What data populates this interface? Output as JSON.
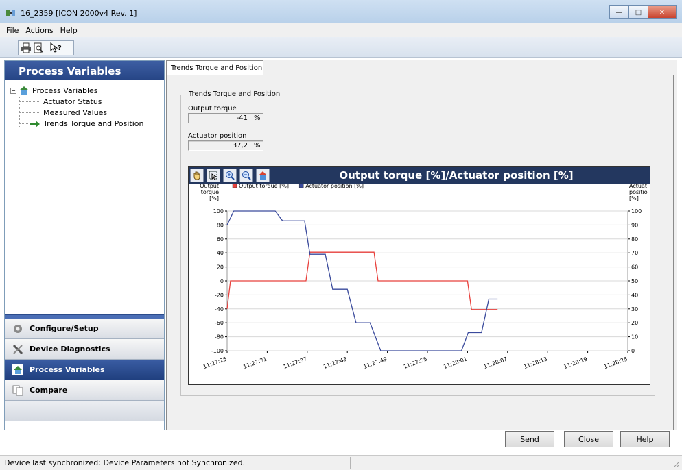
{
  "window": {
    "title": "16_2359 [ICON 2000v4 Rev. 1]",
    "controls": [
      "minimize",
      "maximize",
      "close"
    ]
  },
  "menu": [
    "File",
    "Actions",
    "Help"
  ],
  "toolbar": {
    "icons": [
      "print-icon",
      "print-preview-icon",
      "context-help-icon"
    ]
  },
  "left_panel": {
    "header": "Process Variables",
    "tree": {
      "root": "Process Variables",
      "children": [
        "Actuator Status",
        "Measured Values",
        "Trends Torque and Position"
      ],
      "selected": "Trends Torque and Position"
    },
    "nav": [
      {
        "label": "Configure/Setup",
        "icon": "gear-icon",
        "active": false
      },
      {
        "label": "Device Diagnostics",
        "icon": "tools-icon",
        "active": false
      },
      {
        "label": "Process Variables",
        "icon": "home-icon",
        "active": true
      },
      {
        "label": "Compare",
        "icon": "compare-icon",
        "active": false
      }
    ]
  },
  "main": {
    "tab": "Trends Torque and Position",
    "group_title": "Trends Torque and Position",
    "output_torque": {
      "label": "Output torque",
      "value": "-41",
      "unit": "%"
    },
    "actuator_position": {
      "label": "Actuator position",
      "value": "37,2",
      "unit": "%"
    }
  },
  "chart_data": {
    "type": "line",
    "title": "Output torque [%]/Actuator position [%]",
    "toolbar_icons": [
      "pan-hand-icon",
      "zoom-select-icon",
      "zoom-in-icon",
      "zoom-out-icon",
      "home-icon"
    ],
    "ylabel_left": "Output torque [%]",
    "ylabel_right": "Actuator position [%]",
    "ylim_left": [
      -100,
      100
    ],
    "ylim_right": [
      0,
      100
    ],
    "y_ticks_left": [
      "100",
      "80",
      "60",
      "40",
      "20",
      "0",
      "-20",
      "-40",
      "-60",
      "-80",
      "-100"
    ],
    "y_ticks_right": [
      "100",
      "90",
      "80",
      "70",
      "60",
      "50",
      "40",
      "30",
      "20",
      "10",
      "0"
    ],
    "x_ticks": [
      "11:27:25",
      "11:27:31",
      "11:27:37",
      "11:27:43",
      "11:27:49",
      "11:27:55",
      "11:28:01",
      "11:28:07",
      "11:28:13",
      "11:28:19",
      "11:28:25"
    ],
    "x_seconds_range": [
      0,
      60
    ],
    "grid": true,
    "legend_placement": "top-left",
    "series": [
      {
        "name": "Output torque [%]",
        "axis": "left",
        "color": "#e8403c",
        "points": [
          [
            0,
            -40
          ],
          [
            0.5,
            0
          ],
          [
            11.8,
            0
          ],
          [
            12.4,
            41
          ],
          [
            22,
            41
          ],
          [
            22.6,
            0
          ],
          [
            36,
            0
          ],
          [
            36.6,
            -41
          ],
          [
            40.5,
            -41
          ]
        ]
      },
      {
        "name": "Actuator position [%]",
        "axis": "right",
        "color": "#3a4a9c",
        "points": [
          [
            0,
            90
          ],
          [
            1,
            100
          ],
          [
            7.2,
            100
          ],
          [
            8.3,
            93
          ],
          [
            11.6,
            93
          ],
          [
            12.4,
            69
          ],
          [
            14.7,
            69
          ],
          [
            15.8,
            44
          ],
          [
            18,
            44
          ],
          [
            19.3,
            20
          ],
          [
            21.4,
            20
          ],
          [
            23,
            0
          ],
          [
            35.1,
            0
          ],
          [
            36.1,
            13
          ],
          [
            38.1,
            13
          ],
          [
            39.2,
            37
          ],
          [
            40.5,
            37
          ]
        ]
      }
    ]
  },
  "buttons": {
    "send": "Send",
    "close": "Close",
    "help": "Help"
  },
  "status": {
    "text": "Device last synchronized: Device Parameters not Synchronized."
  }
}
